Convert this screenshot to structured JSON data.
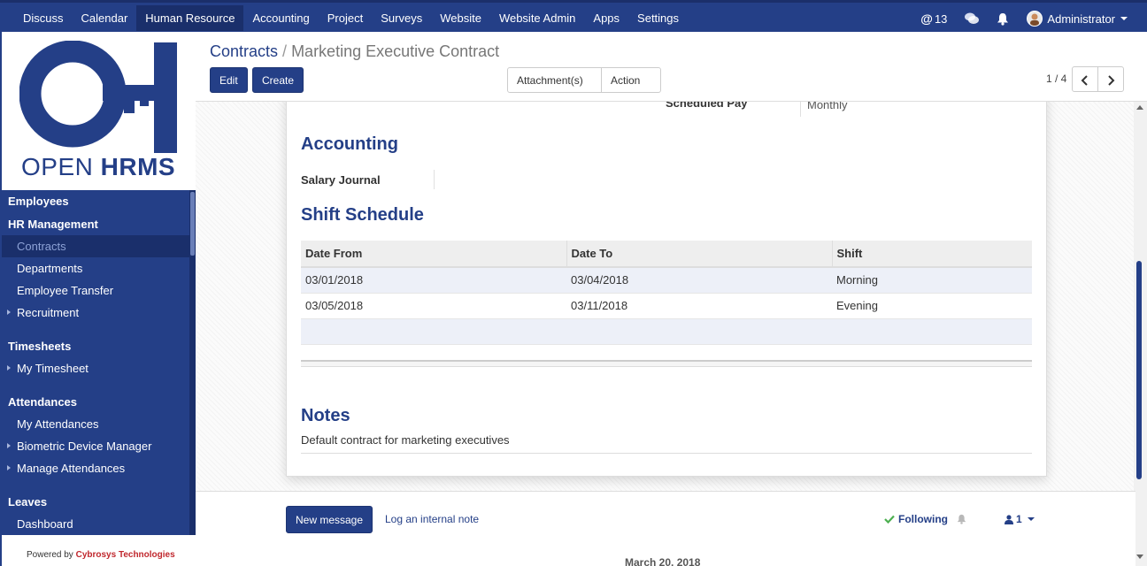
{
  "topbar": {
    "menu": [
      "Discuss",
      "Calendar",
      "Human Resource",
      "Accounting",
      "Project",
      "Surveys",
      "Website",
      "Website Admin",
      "Apps",
      "Settings"
    ],
    "active_menu": "Human Resource",
    "mentions_count": "13",
    "user": "Administrator"
  },
  "sidebar": {
    "logo_open": "OPEN",
    "logo_hrms": "HRMS",
    "sections": [
      {
        "head": "Employees"
      },
      {
        "head": "HR Management",
        "items": [
          "Contracts",
          "Departments",
          "Employee Transfer",
          "Recruitment"
        ]
      },
      {
        "head": "Timesheets",
        "items": [
          "My Timesheet"
        ]
      },
      {
        "head": "Attendances",
        "items": [
          "My Attendances",
          "Biometric Device Manager",
          "Manage Attendances"
        ]
      },
      {
        "head": "Leaves",
        "items": [
          "Dashboard"
        ]
      }
    ],
    "powered_prefix": "Powered by",
    "powered_company": "Cybrosys Technologies"
  },
  "control_panel": {
    "breadcrumb_parent": "Contracts",
    "breadcrumb_current": "Marketing Executive Contract",
    "edit_label": "Edit",
    "create_label": "Create",
    "attachments_label": "Attachment(s)",
    "action_label": "Action",
    "pager": "1 / 4"
  },
  "form": {
    "scheduled_pay_label": "Scheduled Pay",
    "scheduled_pay_value": "Monthly",
    "accounting_title": "Accounting",
    "salary_journal_label": "Salary Journal",
    "shift_title": "Shift Schedule",
    "shift_columns": [
      "Date From",
      "Date To",
      "Shift"
    ],
    "shift_rows": [
      [
        "03/01/2018",
        "03/04/2018",
        "Morning"
      ],
      [
        "03/05/2018",
        "03/11/2018",
        "Evening"
      ]
    ],
    "notes_title": "Notes",
    "notes_text": "Default contract for marketing executives"
  },
  "chatter": {
    "new_message": "New message",
    "log_note": "Log an internal note",
    "following": "Following",
    "followers": "1",
    "date_separator": "March 20, 2018"
  }
}
